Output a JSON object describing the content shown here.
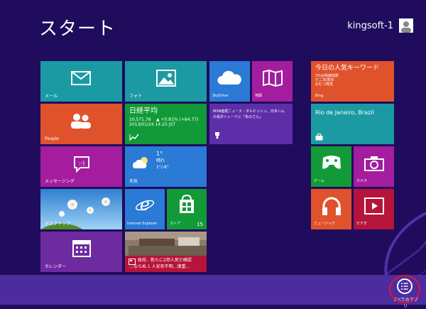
{
  "screen": {
    "title": "スタート"
  },
  "user": {
    "name": "kingsoft-1",
    "icon": "user-avatar-icon"
  },
  "colors": {
    "background": "#1f0c5c",
    "teal": "#1b9aa4",
    "orange": "#e0522b",
    "purple": "#6e2ba0",
    "magenta": "#a41d9e",
    "blue": "#2a7ad6",
    "green": "#139a38",
    "red": "#b6143a",
    "darkpurple": "#5e2ea8"
  },
  "tiles": {
    "mail": {
      "label": "メール",
      "icon": "mail-icon"
    },
    "photos": {
      "label": "フォト",
      "icon": "photo-icon"
    },
    "skydrive": {
      "label": "SkyDrive",
      "icon": "cloud-icon"
    },
    "maps": {
      "label": "地図",
      "icon": "map-icon"
    },
    "people": {
      "label": "People",
      "icon": "people-icon"
    },
    "finance": {
      "title": "日経平均",
      "value": "10,571.76",
      "change": "▲ +0.81% (+84.77)",
      "date": "2013/01/24 14:25 JST",
      "icon": "chart-icon"
    },
    "news": {
      "text1": "MSN産経ニュース・ダルビッシュ、日本ハム",
      "text2": "の長井トレードに「あのさん」",
      "icon": "trophy-icon"
    },
    "messaging": {
      "label": "メッセージング",
      "icon": "message-icon"
    },
    "weather": {
      "label": "天気",
      "temp": "1°",
      "cond1": "晴れ",
      "cond2": "1°/-8°",
      "icon": "cloud-sun-icon"
    },
    "desktop": {
      "label": "デスクトップ"
    },
    "ie": {
      "label": "Internet Explorer",
      "icon": "ie-icon"
    },
    "store": {
      "label": "ストア",
      "badge": "15",
      "icon": "store-icon"
    },
    "calendar": {
      "label": "カレンダー",
      "icon": "calendar-icon"
    },
    "photo_news": {
      "line1": "政府、新たに2邦人死亡確認",
      "line2": "…ならぬ 1 人安否不明…慎重…",
      "icon": "news-icon"
    },
    "bing": {
      "title": "今日の人気キーワード",
      "k1": "2%台株価指数",
      "k2": "ビニ30周年",
      "k3": "おむつ発見",
      "label": "Bing"
    },
    "travel": {
      "city": "Rio de Janeiro, Brazil",
      "icon": "suitcase-icon"
    },
    "games": {
      "label": "ゲーム",
      "icon": "gamepad-icon"
    },
    "camera": {
      "label": "カメラ",
      "icon": "camera-icon"
    },
    "music": {
      "label": "ミュージック",
      "icon": "headphones-icon"
    },
    "video": {
      "label": "ビデオ",
      "icon": "play-icon"
    }
  },
  "allapps": {
    "label": "すべてのアプリ",
    "icon": "list-icon"
  }
}
